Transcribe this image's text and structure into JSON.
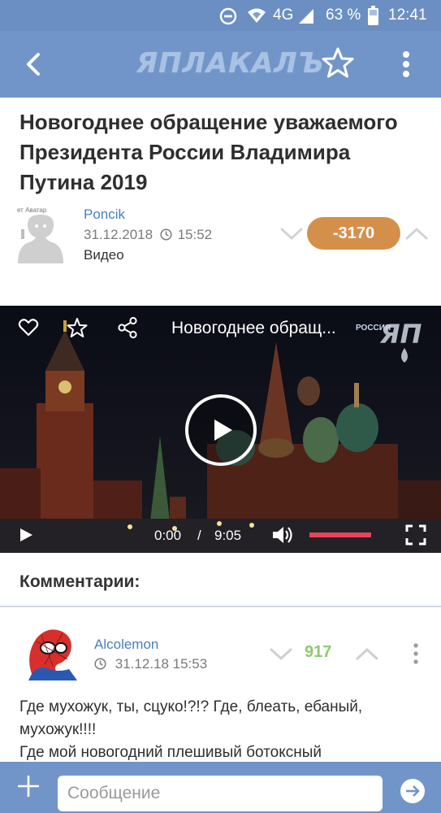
{
  "status_bar": {
    "network": "4G",
    "battery": "63 %",
    "time": "12:41",
    "icons": [
      "dnd-icon",
      "wifi-icon",
      "signal-icon",
      "battery-icon"
    ]
  },
  "app_header": {
    "logo_text": "ЯПЛАКАЛЪ",
    "icons": [
      "back-arrow-icon",
      "star-outline-icon",
      "more-vertical-icon"
    ]
  },
  "post": {
    "title": "Новогоднее обращение уважаемого Президента России Владимира Путина 2019",
    "avatar_text": "ет Аватар",
    "author": "Poncik",
    "date": "31.12.2018",
    "time": "15:52",
    "type": "Видео",
    "rating": "-3170"
  },
  "video": {
    "title": "Новогоднее обращ...",
    "channel_badge": "РОССИЯ",
    "current_time": "0:00",
    "separator": "/",
    "duration": "9:05",
    "watermark": "ЯП"
  },
  "comments": {
    "heading": "Комментарии:",
    "items": [
      {
        "author": "Alcolemon",
        "datetime": "31.12.18 15:53",
        "score": "917",
        "text": "Где мухожук, ты, сцуко!?!? Где, блеать, ебаный, мухожук!!!!\nГде мой новогодний плешивый ботоксный"
      }
    ]
  },
  "input_bar": {
    "placeholder": "Сообщение"
  },
  "colors": {
    "header_blue": "#7295c9",
    "rating_orange": "#d4904a",
    "score_green": "#8acb6e",
    "link_blue": "#4a7fbd",
    "volume_red": "#e8445a"
  }
}
